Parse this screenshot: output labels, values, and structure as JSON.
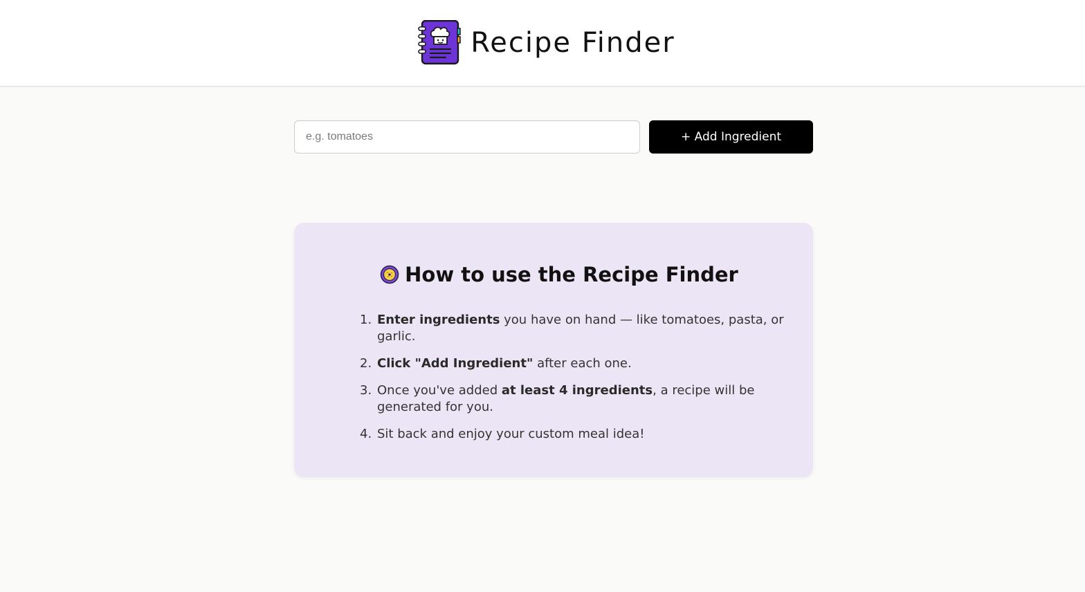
{
  "header": {
    "title": "Recipe Finder",
    "logo_icon": "cookbook-chef-icon"
  },
  "search": {
    "placeholder": "e.g. tomatoes",
    "value": "",
    "add_button_label": "+ Add Ingredient"
  },
  "instructions": {
    "icon": "compass-icon",
    "title": "How to use the Recipe Finder",
    "steps": [
      {
        "number": "1.",
        "bold": "Enter ingredients",
        "rest": " you have on hand — like tomatoes, pasta, or garlic."
      },
      {
        "number": "2.",
        "bold": "Click \"Add Ingredient\"",
        "rest": " after each one."
      },
      {
        "number": "3.",
        "before": "Once you've added ",
        "bold": "at least 4 ingredients",
        "rest": ", a recipe will be generated for you."
      },
      {
        "number": "4.",
        "text": "Sit back and enjoy your custom meal idea!"
      }
    ]
  },
  "colors": {
    "logo_purple": "#6d35d8",
    "card_background": "#ece5f5",
    "button_background": "#000000",
    "page_background": "#fafaf8"
  }
}
